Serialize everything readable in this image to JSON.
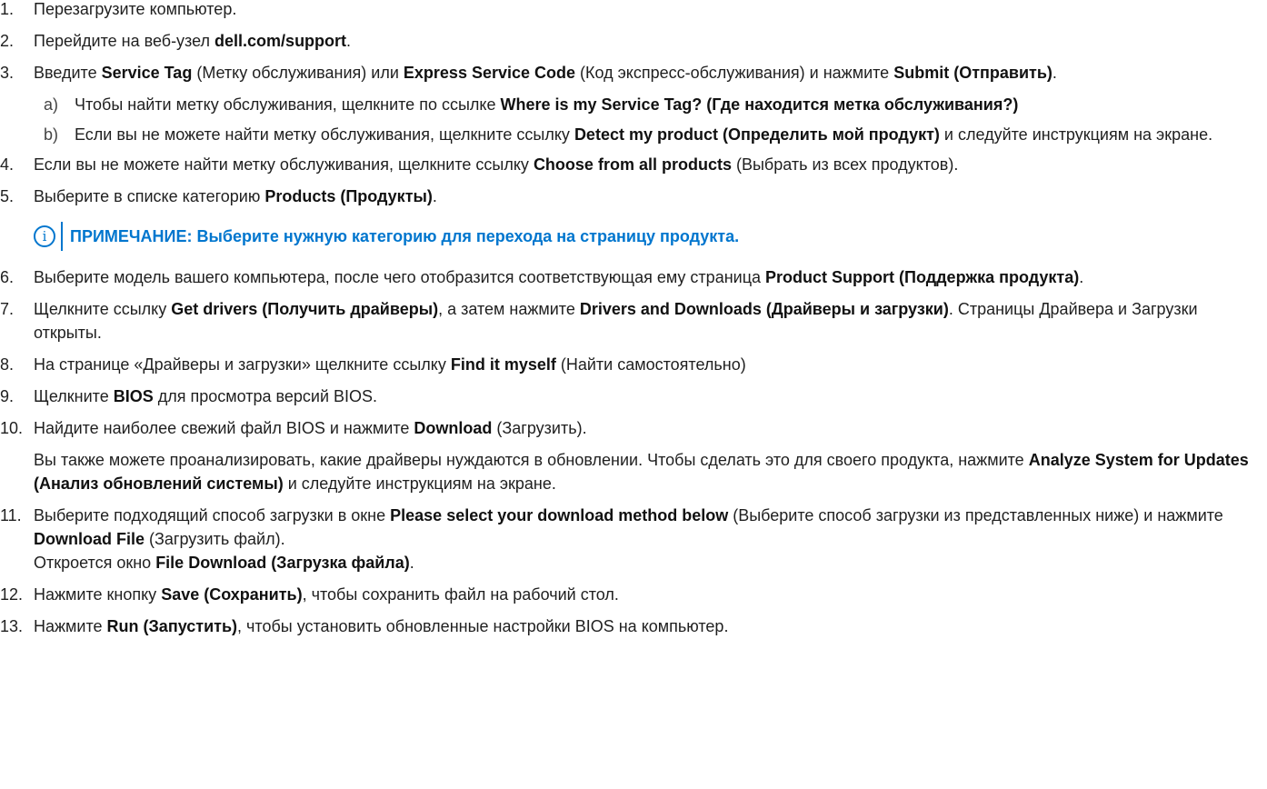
{
  "steps": [
    {
      "num": "1.",
      "parts": [
        "Перезагрузите компьютер."
      ]
    },
    {
      "num": "2.",
      "parts": [
        "Перейдите на веб-узел ",
        "dell.com/support",
        "."
      ]
    },
    {
      "num": "3.",
      "parts": [
        "Введите ",
        "Service Tag",
        " (Метку обслуживания) или ",
        "Express Service Code",
        " (Код экспресс-обслуживания) и нажмите ",
        "Submit (Отправить)",
        "."
      ],
      "subs": [
        {
          "letter": "a)",
          "parts": [
            "Чтобы найти метку обслуживания, щелкните по ссылке ",
            "Where is my Service Tag? (Где находится метка обслуживания?)"
          ]
        },
        {
          "letter": "b)",
          "parts": [
            "Если вы не можете найти метку обслуживания, щелкните ссылку ",
            "Detect my product (Определить мой продукт)",
            " и следуйте инструкциям на экране."
          ]
        }
      ]
    },
    {
      "num": "4.",
      "parts": [
        "Если вы не можете найти метку обслуживания, щелкните ссылку ",
        "Choose from all products",
        " (Выбрать из всех продуктов)."
      ]
    },
    {
      "num": "5.",
      "parts": [
        "Выберите в списке категорию ",
        "Products (Продукты)",
        "."
      ]
    },
    {
      "num": "6.",
      "parts": [
        "Выберите модель вашего компьютера, после чего отобразится соответствующая ему страница ",
        "Product Support (Поддержка продукта)",
        "."
      ]
    },
    {
      "num": "7.",
      "parts": [
        "Щелкните ссылку ",
        "Get drivers (Получить драйверы)",
        ", а затем нажмите ",
        "Drivers and Downloads (Драйверы и загрузки)",
        ". Страницы Драйвера и Загрузки открыты."
      ]
    },
    {
      "num": "8.",
      "parts": [
        "На странице «Драйверы и загрузки» щелкните ссылку ",
        "Find it myself",
        " (Найти самостоятельно)"
      ]
    },
    {
      "num": "9.",
      "parts": [
        "Щелкните ",
        "BIOS",
        " для просмотра версий BIOS."
      ]
    },
    {
      "num": "10.",
      "parts": [
        "Найдите наиболее свежий файл BIOS и нажмите ",
        "Download",
        " (Загрузить)."
      ]
    },
    {
      "num": "11.",
      "parts": [
        "Выберите подходящий способ загрузки в окне ",
        "Please select your download method below",
        " (Выберите способ загрузки из представленных ниже) и нажмите ",
        "Download File",
        " (Загрузить файл)."
      ],
      "tail": [
        "Откроется окно ",
        "File Download (Загрузка файла)",
        "."
      ]
    },
    {
      "num": "12.",
      "parts": [
        "Нажмите кнопку ",
        "Save (Сохранить)",
        ", чтобы сохранить файл на рабочий стол."
      ]
    },
    {
      "num": "13.",
      "parts": [
        "Нажмите ",
        "Run (Запустить)",
        ", чтобы установить обновленные настройки BIOS на компьютер."
      ]
    }
  ],
  "note": {
    "icon": "info-icon",
    "label": "ПРИМЕЧАНИЕ:",
    "text": " Выберите нужную категорию для перехода на страницу продукта.",
    "color": "#0076ce"
  },
  "after_step_10": {
    "parts": [
      "Вы также можете проанализировать, какие драйверы нуждаются в обновлении. Чтобы сделать это для своего продукта, нажмите ",
      "Analyze System for Updates (Анализ обновлений системы)",
      " и следуйте инструкциям на экране."
    ]
  }
}
